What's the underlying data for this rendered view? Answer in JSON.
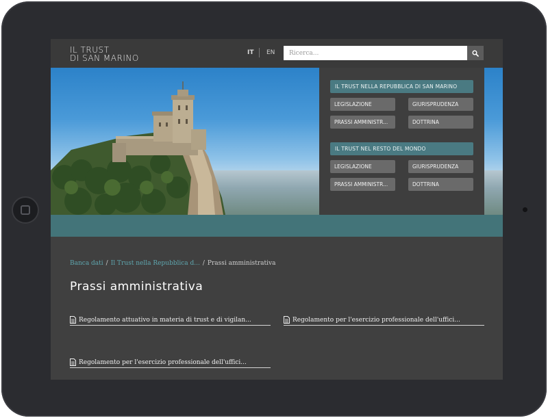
{
  "site": {
    "logo_line1": "IL TRUST",
    "logo_line2": "DI SAN MARINO"
  },
  "header": {
    "lang_it": "IT",
    "lang_en": "EN",
    "search_placeholder": "Ricerca..."
  },
  "panel": {
    "section1": {
      "title": "IL TRUST NELLA REPUBBLICA DI SAN MARINO",
      "items": [
        "LEGISLAZIONE",
        "GIURISPRUDENZA",
        "PRASSI AMMINISTR...",
        "DOTTRINA"
      ]
    },
    "section2": {
      "title": "IL TRUST NEL RESTO DEL MONDO",
      "items": [
        "LEGISLAZIONE",
        "GIURISPRUDENZA",
        "PRASSI AMMINISTR...",
        "DOTTRINA"
      ]
    }
  },
  "breadcrumb": {
    "items": [
      "Banca dati",
      "Il Trust nella Repubblica d...",
      "Prassi amministrativa"
    ]
  },
  "page": {
    "title": "Prassi amministrativa"
  },
  "documents": [
    "Regolamento attuativo in materia di trust e di vigilan...",
    "Regolamento per l'esercizio professionale dell'uffici...",
    "Regolamento per l'esercizio professionale dell'uffici..."
  ],
  "colors": {
    "accent_teal": "#437479",
    "panel_title_bg": "#4a7a82",
    "panel_button_bg": "#6a6a6a",
    "link": "#5fa7b0"
  },
  "icons": {
    "search": "search-icon",
    "document": "document-icon"
  }
}
